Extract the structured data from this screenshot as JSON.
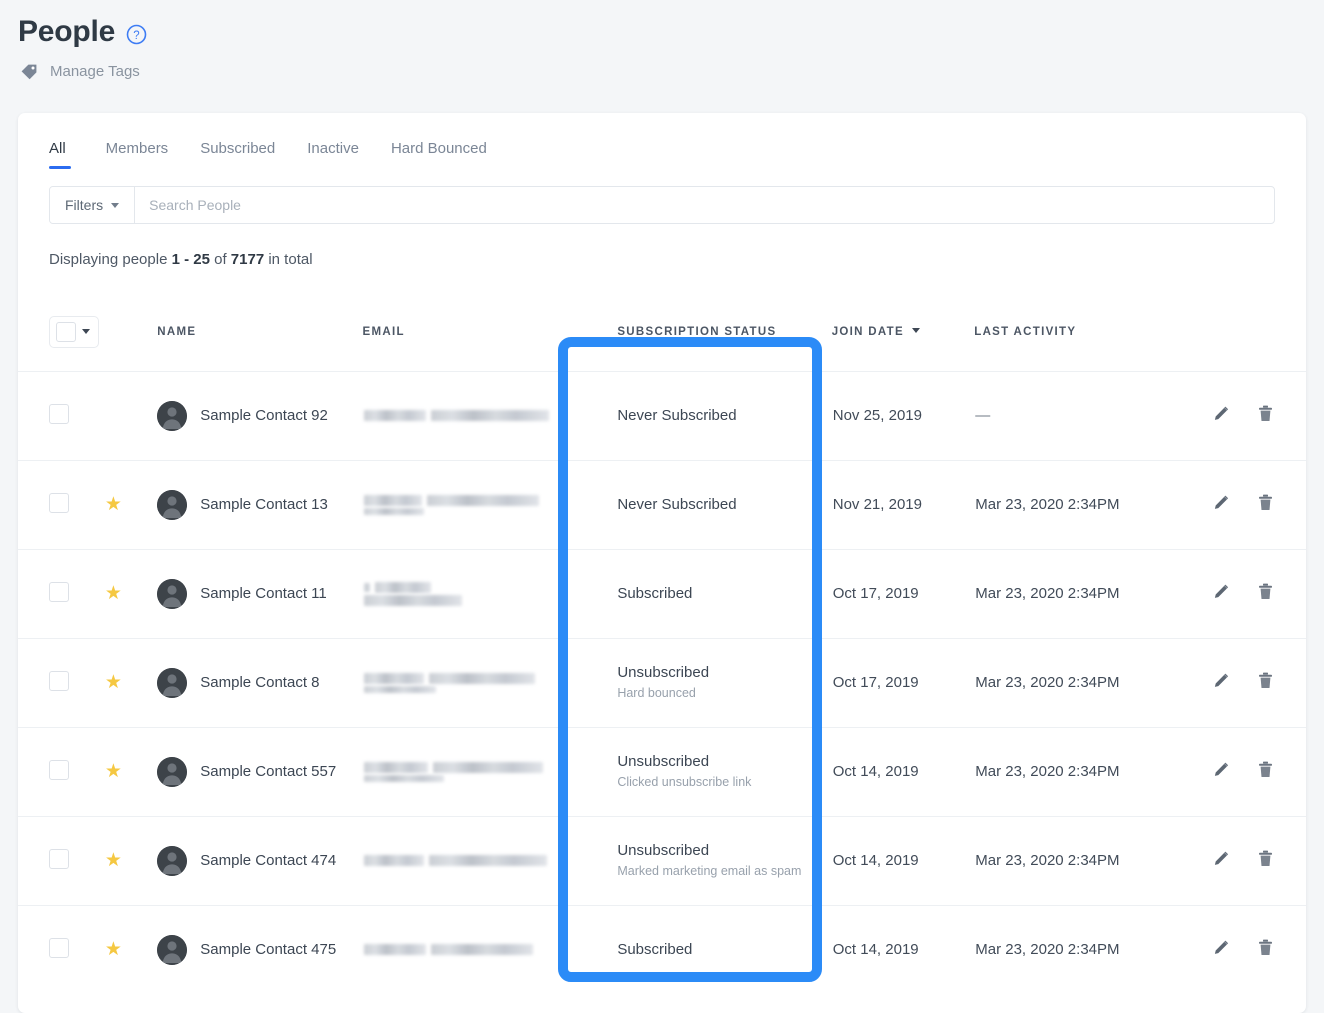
{
  "header": {
    "title": "People",
    "help_icon": "help-circle-icon",
    "manage_tags_label": "Manage Tags",
    "tag_icon": "tag-icon"
  },
  "tabs": [
    {
      "label": "All",
      "active": true
    },
    {
      "label": "Members",
      "active": false
    },
    {
      "label": "Subscribed",
      "active": false
    },
    {
      "label": "Inactive",
      "active": false
    },
    {
      "label": "Hard Bounced",
      "active": false
    }
  ],
  "toolbar": {
    "filters_label": "Filters",
    "search_placeholder": "Search People",
    "search_value": ""
  },
  "count": {
    "prefix": "Displaying people ",
    "range": "1 - 25",
    "middle": " of ",
    "total": "7177",
    "suffix": " in total"
  },
  "table": {
    "headers": {
      "name": "NAME",
      "email": "EMAIL",
      "subscription_status": "SUBSCRIPTION STATUS",
      "join_date": "JOIN DATE",
      "last_activity": "LAST ACTIVITY"
    },
    "sorted_column": "JOIN DATE",
    "rows": [
      {
        "name": "Sample Contact 92",
        "starred": false,
        "email_redacted": true,
        "status": "Never Subscribed",
        "status_reason": "",
        "join_date": "Nov 25, 2019",
        "last_activity": "—"
      },
      {
        "name": "Sample Contact 13",
        "starred": true,
        "email_redacted": true,
        "status": "Never Subscribed",
        "status_reason": "",
        "join_date": "Nov 21, 2019",
        "last_activity": "Mar 23, 2020 2:34PM"
      },
      {
        "name": "Sample Contact 11",
        "starred": true,
        "email_redacted": true,
        "status": "Subscribed",
        "status_reason": "",
        "join_date": "Oct 17, 2019",
        "last_activity": "Mar 23, 2020 2:34PM"
      },
      {
        "name": "Sample Contact 8",
        "starred": true,
        "email_redacted": true,
        "status": "Unsubscribed",
        "status_reason": "Hard bounced",
        "join_date": "Oct 17, 2019",
        "last_activity": "Mar 23, 2020 2:34PM"
      },
      {
        "name": "Sample Contact 557",
        "starred": true,
        "email_redacted": true,
        "status": "Unsubscribed",
        "status_reason": "Clicked unsubscribe link",
        "join_date": "Oct 14, 2019",
        "last_activity": "Mar 23, 2020 2:34PM"
      },
      {
        "name": "Sample Contact 474",
        "starred": true,
        "email_redacted": true,
        "status": "Unsubscribed",
        "status_reason": "Marked marketing email as spam",
        "join_date": "Oct 14, 2019",
        "last_activity": "Mar 23, 2020 2:34PM"
      },
      {
        "name": "Sample Contact 475",
        "starred": true,
        "email_redacted": true,
        "status": "Subscribed",
        "status_reason": "",
        "join_date": "Oct 14, 2019",
        "last_activity": "Mar 23, 2020 2:34PM"
      }
    ],
    "row_icons": {
      "edit": "pencil-icon",
      "delete": "trash-icon",
      "star": "star-icon",
      "avatar": "avatar-icon"
    }
  },
  "annotation": {
    "target_column": "SUBSCRIPTION STATUS",
    "color": "#2b8bf7"
  },
  "colors": {
    "page_background": "#f4f6f8",
    "card_background": "#ffffff",
    "accent": "#2b6cf0",
    "annotation": "#2b8bf7",
    "star": "#f5c842",
    "muted_text": "#98a1ac"
  }
}
